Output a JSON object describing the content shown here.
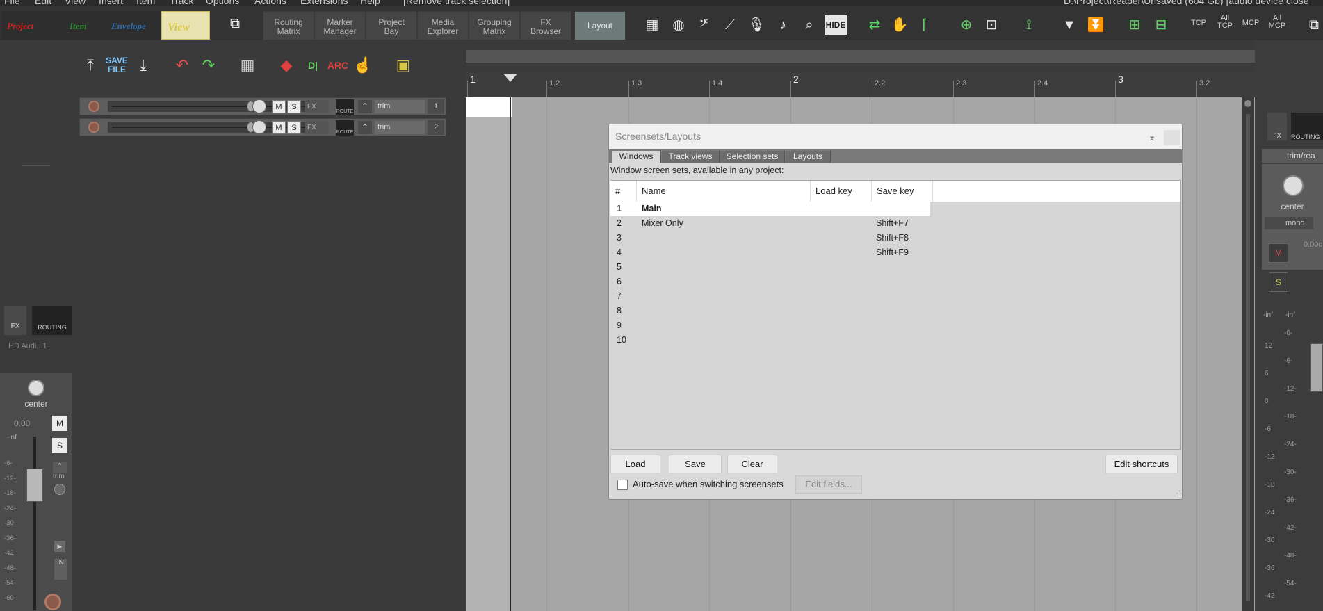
{
  "menu": [
    "File",
    "Edit",
    "View",
    "Insert",
    "Item",
    "Track",
    "Options",
    "Actions",
    "Extensions",
    "Help"
  ],
  "menu_status": "[Remove track selection]",
  "window_title": "D:\\Project\\Reaper\\Unsaved (604 Gb) [audio device close",
  "toolbar": {
    "context_tabs": [
      {
        "label": "Project",
        "color": "#d81f1f"
      },
      {
        "label": "Item",
        "color": "#2e8b2e"
      },
      {
        "label": "Envelope",
        "color": "#2f6fb0"
      },
      {
        "label": "View",
        "color": "#d8c64a"
      }
    ],
    "view_buttons": [
      {
        "label": "Routing\nMatrix"
      },
      {
        "label": "Marker\nManager"
      },
      {
        "label": "Project\nBay"
      },
      {
        "label": "Media\nExplorer"
      },
      {
        "label": "Grouping\nMatrix"
      },
      {
        "label": "FX\nBrowser"
      },
      {
        "label": "Layout"
      }
    ],
    "hide_label": "HIDE",
    "tcp_labels": [
      "TCP",
      "All\nTCP",
      "MCP",
      "All\nMCP"
    ]
  },
  "tcp_toolbar": {
    "save_file_label": "SAVE\nFILE"
  },
  "tracks": [
    {
      "number": "1",
      "mute": "M",
      "solo": "S",
      "fx": "FX",
      "route": "ROUTE",
      "trim": "trim"
    },
    {
      "number": "2",
      "mute": "M",
      "solo": "S",
      "fx": "FX",
      "route": "ROUTE",
      "trim": "trim"
    }
  ],
  "master": {
    "fx": "FX",
    "routing": "ROUTING",
    "device": "HD Audi...1",
    "pan": "center",
    "volume": "0.00",
    "inf": "-inf",
    "mute": "M",
    "solo": "S",
    "trim": "trim",
    "in": "IN",
    "scale": [
      "-6-",
      "-12-",
      "-18-",
      "-24-",
      "-30-",
      "-36-",
      "-42-",
      "-48-",
      "-54-",
      "-60-"
    ]
  },
  "ruler": {
    "major": [
      "1",
      "2",
      "3"
    ],
    "minor": [
      "1.2",
      "1.3",
      "1.4",
      "2.2",
      "2.3",
      "2.4",
      "3.2"
    ]
  },
  "right_mixer": {
    "fx": "FX",
    "routing": "ROUTING",
    "trim": "trim/rea",
    "pan": "center",
    "mono": "mono",
    "volume": "0.00c",
    "mute": "M",
    "solo": "S",
    "inf_left": "-inf",
    "inf_right": "-inf",
    "scale_left": [
      "12",
      "6",
      "0",
      "-6",
      "-12",
      "-18",
      "-24",
      "-30",
      "-36",
      "-42"
    ],
    "scale_right": [
      "-0-",
      "-6-",
      "-12-",
      "-18-",
      "-24-",
      "-30-",
      "-36-",
      "-42-",
      "-48-",
      "-54-"
    ]
  },
  "dialog": {
    "title": "Screensets/Layouts",
    "tabs": [
      "Windows",
      "Track views",
      "Selection sets",
      "Layouts"
    ],
    "active_tab": "Windows",
    "caption": "Window screen sets, available in any project:",
    "columns": [
      "#",
      "Name",
      "Load key",
      "Save key"
    ],
    "rows": [
      {
        "num": "1",
        "name": "Main",
        "load": "",
        "save": ""
      },
      {
        "num": "2",
        "name": "Mixer Only",
        "load": "",
        "save": "Shift+F7"
      },
      {
        "num": "3",
        "name": "",
        "load": "",
        "save": "Shift+F8"
      },
      {
        "num": "4",
        "name": "",
        "load": "",
        "save": "Shift+F9"
      },
      {
        "num": "5",
        "name": "",
        "load": "",
        "save": ""
      },
      {
        "num": "6",
        "name": "",
        "load": "",
        "save": ""
      },
      {
        "num": "7",
        "name": "",
        "load": "",
        "save": ""
      },
      {
        "num": "8",
        "name": "",
        "load": "",
        "save": ""
      },
      {
        "num": "9",
        "name": "",
        "load": "",
        "save": ""
      },
      {
        "num": "10",
        "name": "",
        "load": "",
        "save": ""
      }
    ],
    "buttons": {
      "load": "Load",
      "save": "Save",
      "clear": "Clear",
      "edit_shortcuts": "Edit shortcuts",
      "edit_fields": "Edit fields..."
    },
    "autosave_label": "Auto-save when switching screensets"
  }
}
